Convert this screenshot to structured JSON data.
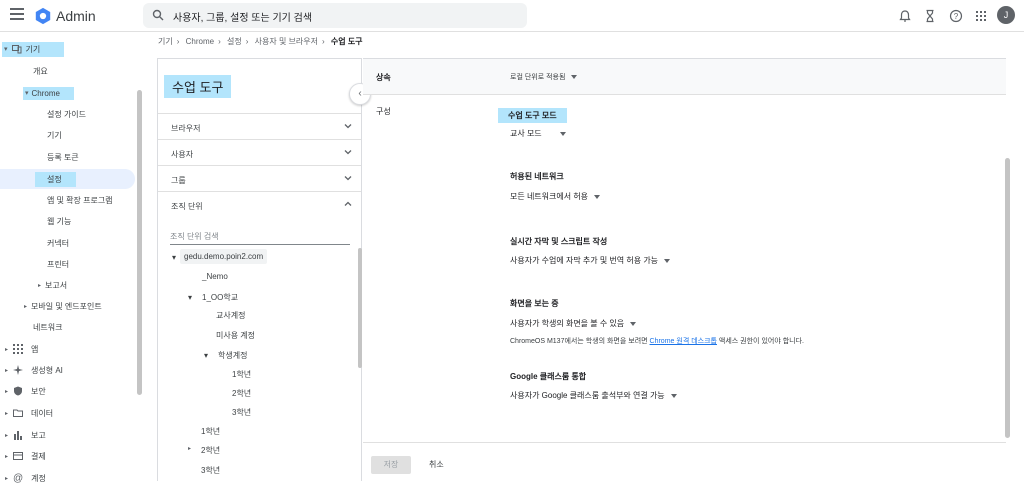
{
  "app": {
    "brand": "Admin",
    "avatar_initial": "J"
  },
  "search": {
    "placeholder": "사용자, 그룹, 설정 또는 기기 검색"
  },
  "breadcrumb": [
    "기기",
    "Chrome",
    "설정",
    "사용자 및 브라우저",
    "수업 도구"
  ],
  "sidebar": {
    "devices": "기기",
    "overview": "개요",
    "chrome": "Chrome",
    "setup_guide": "설정 가이드",
    "devices_sub": "기기",
    "enroll_token": "등록 토큰",
    "settings": "설정",
    "apps_extensions": "앱 및 확장 프로그램",
    "web_features": "웹 기능",
    "connectors": "커넥터",
    "printers": "프린터",
    "reports": "보고서",
    "mobile_endpoints": "모바일 및 엔드포인트",
    "network": "네트워크",
    "apps": "앱",
    "gen_ai": "생성형 AI",
    "security": "보안",
    "data": "데이터",
    "report": "보고",
    "billing": "결제",
    "account": "계정"
  },
  "mid": {
    "title": "수업 도구",
    "accordions": [
      "브라우저",
      "사용자",
      "그룹",
      "조직 단위"
    ],
    "org_search_placeholder": "조직 단위 검색",
    "tree": {
      "root": "gedu.demo.poin2.com",
      "nemo": "_Nemo",
      "school1": "1_OO학교",
      "teacher_acct": "교사계정",
      "unused_acct": "미사용 계정",
      "student_acct": "학생계정",
      "g1": "1학년",
      "g2": "2학년",
      "g3": "3학년",
      "top_g1": "1학년",
      "top_g2": "2학년",
      "top_g3": "3학년"
    }
  },
  "right": {
    "inherit_label": "상속",
    "inherit_value": "로컬 단위로 적용됨",
    "config_label": "구성",
    "class_tools_mode_title": "수업 도구 모드",
    "class_tools_mode_value": "교사 모드",
    "allowed_network_title": "허용된 네트워크",
    "allowed_network_value": "모든 네트워크에서 허용",
    "captions_title": "실시간 자막 및 스크립트 작성",
    "captions_value": "사용자가 수업에 자막 추가 및 번역 허용 가능",
    "screen_view_title": "화면을 보는 중",
    "screen_view_value": "사용자가 학생의 화면을 볼 수 있음",
    "screen_note_prefix": "ChromeOS M137에서는 학생의 화면을 보려면 ",
    "screen_note_link": "Chrome 원격 데스크톱",
    "screen_note_suffix": " 액세스 권한이 있어야 합니다.",
    "classroom_title": "Google 클래스룸 통합",
    "classroom_value": "사용자가 Google 클래스룸 출석부와 연결 가능"
  },
  "footer": {
    "save": "저장",
    "cancel": "취소"
  },
  "colors": {
    "highlight": "#b3e5fc",
    "accent": "#1a73e8",
    "selected_row": "#e8f0fe"
  }
}
